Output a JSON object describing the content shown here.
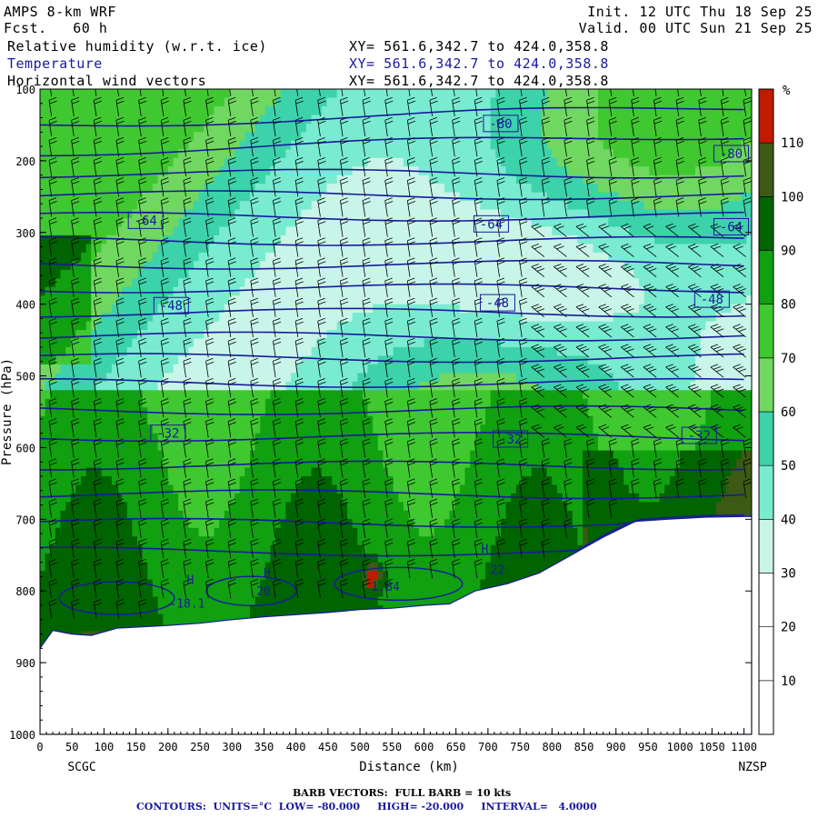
{
  "header": {
    "model": "AMPS 8-km WRF",
    "forecast": "Fcst.   60 h",
    "init": "Init. 12 UTC Thu 18 Sep 25",
    "valid": "Valid. 00 UTC Sun 21 Sep 25",
    "fields": [
      {
        "name": "Relative humidity (w.r.t. ice)",
        "xy": "XY= 561.6,342.7 to 424.0,358.8"
      },
      {
        "name": "Temperature",
        "xy": "XY= 561.6,342.7 to 424.0,358.8"
      },
      {
        "name": "Horizontal wind vectors",
        "xy": "XY= 561.6,342.7 to 424.0,358.8"
      }
    ]
  },
  "colors": {
    "temperature_contour": "#1a1a9e",
    "barbs": "#000000",
    "rh_scale": [
      "#ffffff",
      "#ffffff",
      "#ffffff",
      "#c8f5e8",
      "#78ebd0",
      "#3cd2aa",
      "#70d860",
      "#40c830",
      "#10a010",
      "#006400",
      "#3c5a14",
      "#c01a00"
    ]
  },
  "chart_data": {
    "type": "heatmap",
    "xlabel": "Distance (km)",
    "ylabel": "Pressure (hPa)",
    "x_ticks": [
      0,
      50,
      100,
      150,
      200,
      250,
      300,
      350,
      400,
      450,
      500,
      550,
      600,
      650,
      700,
      750,
      800,
      850,
      900,
      950,
      1000,
      1050,
      1100
    ],
    "y_ticks": [
      100,
      200,
      300,
      400,
      500,
      600,
      700,
      800,
      900,
      1000
    ],
    "xlim": [
      0,
      1112
    ],
    "ylim": [
      1000,
      100
    ],
    "x_endpoint_labels": [
      "SCGC",
      "NZSP"
    ],
    "colorbar": {
      "unit": "%",
      "levels": [
        0,
        10,
        20,
        30,
        40,
        50,
        60,
        70,
        80,
        90,
        100,
        110,
        120
      ],
      "tick_labels": [
        10,
        20,
        30,
        40,
        50,
        60,
        70,
        80,
        90,
        100,
        110
      ]
    },
    "temperature_contours": {
      "units": "°C",
      "low": -80.0,
      "high": -20.0,
      "interval": 4.0,
      "labels": [
        {
          "text": "-80",
          "x": 720,
          "p": 148
        },
        {
          "text": "-80",
          "x": 1080,
          "p": 190
        },
        {
          "text": "-64",
          "x": 165,
          "p": 283
        },
        {
          "text": "-64",
          "x": 705,
          "p": 288
        },
        {
          "text": "-64",
          "x": 1080,
          "p": 292
        },
        {
          "text": "-48",
          "x": 205,
          "p": 402
        },
        {
          "text": "-48",
          "x": 715,
          "p": 398
        },
        {
          "text": "-48",
          "x": 1050,
          "p": 393
        },
        {
          "text": "-32",
          "x": 200,
          "p": 580
        },
        {
          "text": "-32",
          "x": 735,
          "p": 588
        },
        {
          "text": "-32",
          "x": 1030,
          "p": 583
        }
      ],
      "extremum_labels": [
        {
          "text": "H",
          "x": 235,
          "p": 790
        },
        {
          "text": "H",
          "x": 355,
          "p": 780
        },
        {
          "text": "H",
          "x": 695,
          "p": 747
        },
        {
          "text": "-18.1",
          "x": 230,
          "p": 823
        },
        {
          "text": "20.",
          "x": 355,
          "p": 806
        },
        {
          "text": "1.84",
          "x": 540,
          "p": 800
        },
        {
          "text": "22",
          "x": 715,
          "p": 776
        }
      ]
    },
    "terrain_surface": [
      {
        "x": 0,
        "p": 880
      },
      {
        "x": 20,
        "p": 855
      },
      {
        "x": 50,
        "p": 860
      },
      {
        "x": 80,
        "p": 862
      },
      {
        "x": 120,
        "p": 852
      },
      {
        "x": 160,
        "p": 850
      },
      {
        "x": 200,
        "p": 848
      },
      {
        "x": 250,
        "p": 845
      },
      {
        "x": 300,
        "p": 840
      },
      {
        "x": 350,
        "p": 836
      },
      {
        "x": 400,
        "p": 833
      },
      {
        "x": 450,
        "p": 830
      },
      {
        "x": 500,
        "p": 826
      },
      {
        "x": 550,
        "p": 824
      },
      {
        "x": 600,
        "p": 820
      },
      {
        "x": 640,
        "p": 818
      },
      {
        "x": 680,
        "p": 800
      },
      {
        "x": 730,
        "p": 790
      },
      {
        "x": 780,
        "p": 775
      },
      {
        "x": 830,
        "p": 750
      },
      {
        "x": 880,
        "p": 725
      },
      {
        "x": 930,
        "p": 703
      },
      {
        "x": 980,
        "p": 700
      },
      {
        "x": 1040,
        "p": 697
      },
      {
        "x": 1112,
        "p": 696
      }
    ],
    "barb_note": "BARB VECTORS:  FULL BARB = 10 kts",
    "contour_note": "CONTOURS:  UNITS=°C  LOW= -80.000     HIGH= -20.000     INTERVAL=   4.0000"
  }
}
